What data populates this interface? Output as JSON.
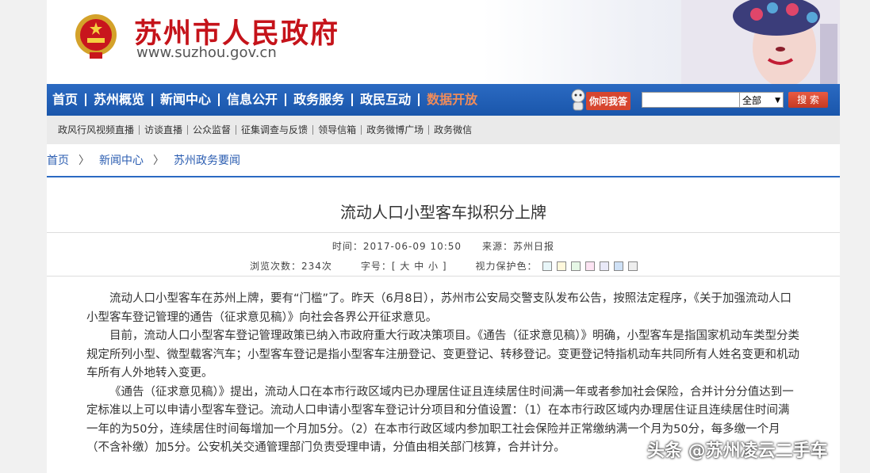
{
  "header": {
    "site_name": "苏州市人民政府",
    "site_url": "www.suzhou.gov.cn"
  },
  "nav": {
    "items": [
      "首页",
      "苏州概览",
      "新闻中心",
      "信息公开",
      "政务服务",
      "政民互动",
      "数据开放"
    ],
    "ask_label": "你问我答",
    "search_placeholder": "",
    "search_scope": "全部",
    "search_button": "搜 索"
  },
  "subnav": {
    "items": [
      "政风行风视频直播",
      "访谈直播",
      "公众监督",
      "征集调查与反馈",
      "领导信箱",
      "政务微博广场",
      "政务微信"
    ]
  },
  "breadcrumb": [
    "首页",
    "新闻中心",
    "苏州政务要闻"
  ],
  "article": {
    "title": "流动人口小型客车拟积分上牌",
    "meta_time": "时间：2017-06-09 10:50　　来源：苏州日报",
    "views": "浏览次数：234次",
    "font_size": "字号：[ 大 中 小 ]",
    "eye_care": "视力保护色：",
    "eye_colors": [
      "#e8f6f9",
      "#fff8dc",
      "#e6f7e6",
      "#fde4f3",
      "#e9e9f8",
      "#cfe1f6",
      "#eeeeee"
    ],
    "paragraphs": [
      "流动人口小型客车在苏州上牌，要有“门槛”了。昨天（6月8日），苏州市公安局交警支队发布公告，按照法定程序，《关于加强流动人口小型客车登记管理的通告（征求意见稿）》向社会各界公开征求意见。",
      "目前，流动人口小型客车登记管理政策已纳入市政府重大行政决策项目。《通告（征求意见稿）》明确，小型客车是指国家机动车类型分类规定所列小型、微型载客汽车；小型客车登记是指小型客车注册登记、变更登记、转移登记。变更登记特指机动车共同所有人姓名变更和机动车所有人外地转入变更。",
      "《通告（征求意见稿）》提出，流动人口在本市行政区域内已办理居住证且连续居住时间满一年或者参加社会保险，合并计分分值达到一定标准以上可以申请小型客车登记。流动人口申请小型客车登记计分项目和分值设置：（1）在本市行政区域内办理居住证且连续居住时间满一年的为50分，连续居住时间每增加一个月加5分。（2）在本市行政区域内参加职工社会保险并正常缴纳满一个月为50分，每多缴一个月（不含补缴）加5分。公安机关交通管理部门负责受理申请，分值由相关部门核算，合并计分。"
    ]
  },
  "watermark": "头条 @苏州凌云二手车"
}
